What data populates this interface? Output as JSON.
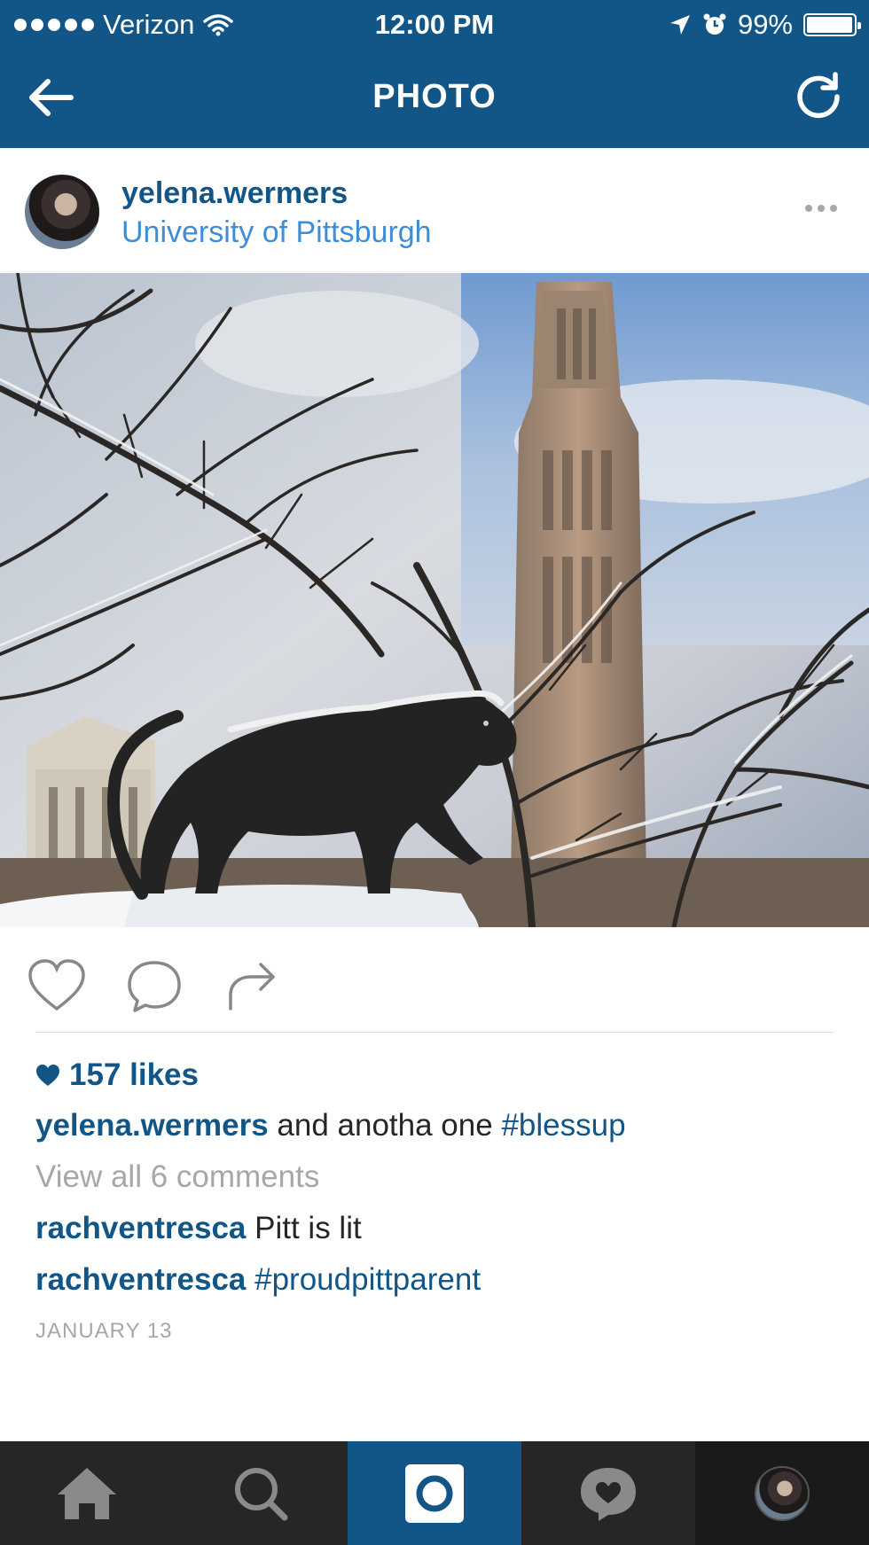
{
  "status_bar": {
    "carrier": "Verizon",
    "time": "12:00 PM",
    "battery": "99%",
    "battery_level": 0.99,
    "icons": [
      "signal-dots-icon",
      "wifi-icon",
      "location-arrow-icon",
      "alarm-icon",
      "battery-icon"
    ]
  },
  "header": {
    "title": "PHOTO",
    "back_icon": "arrow-left-icon",
    "refresh_icon": "refresh-icon"
  },
  "post": {
    "username": "yelena.wermers",
    "location": "University of Pittsburgh",
    "more_icon": "ellipsis-icon",
    "photo_description_icon": "photo"
  },
  "actions": {
    "icons": [
      "heart-outline-icon",
      "comment-bubble-icon",
      "share-arrow-icon"
    ]
  },
  "likes": "157 likes",
  "caption": {
    "user": "yelena.wermers",
    "text": "and anotha one",
    "hashtag": "#blessup"
  },
  "view_all_comments": "View all 6 comments",
  "comments": [
    {
      "user": "rachventresca",
      "text": "Pitt is lit",
      "hashtag": ""
    },
    {
      "user": "rachventresca",
      "text": "",
      "hashtag": "#proudpittparent"
    }
  ],
  "date": "JANUARY 13",
  "tab_bar": {
    "tabs": [
      "home-icon",
      "search-icon",
      "camera-icon",
      "activity-heart-icon",
      "profile-avatar"
    ]
  },
  "colors": {
    "brand": "#125688",
    "link": "#3f8ed5",
    "muted": "#a5a7aa",
    "tabbar": "#262626"
  }
}
